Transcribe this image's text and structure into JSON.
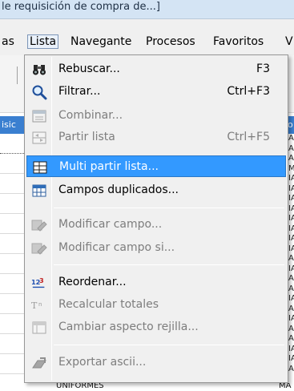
{
  "window": {
    "title": "le requisición de compra de...]"
  },
  "menubar": {
    "items": [
      {
        "label": "as"
      },
      {
        "label": "Lista"
      },
      {
        "label": "Navegante"
      },
      {
        "label": "Procesos"
      },
      {
        "label": "Favoritos"
      },
      {
        "label": "V"
      }
    ]
  },
  "grid": {
    "header_left": "isic",
    "header_right": "o",
    "right_cells": [
      "A",
      "A",
      "AC",
      "M/",
      "IA",
      "IA",
      "IA",
      "IA",
      "IA",
      "IA",
      "IA",
      "IA",
      "A",
      "IA",
      "A",
      "A",
      "IA",
      "A",
      "IA",
      "A",
      "AC",
      "IA",
      "IA",
      "A"
    ],
    "bottom_left": "UNIFORMES",
    "bottom_right": "MA"
  },
  "lista_menu": {
    "items": [
      {
        "label": "Rebuscar...",
        "shortcut": "F3",
        "icon": "binoculars-icon",
        "enabled": true
      },
      {
        "label": "Filtrar...",
        "shortcut": "Ctrl+F3",
        "icon": "magnifier-icon",
        "enabled": true
      },
      {
        "label": "Combinar...",
        "shortcut": "",
        "icon": "combine-window-icon",
        "enabled": false
      },
      {
        "label": "Partir lista",
        "shortcut": "Ctrl+F5",
        "icon": "split-list-icon",
        "enabled": false
      },
      {
        "label": "Multi partir lista...",
        "shortcut": "",
        "icon": "multi-split-icon",
        "enabled": true,
        "highlighted": true
      },
      {
        "label": "Campos duplicados...",
        "shortcut": "",
        "icon": "duplicate-fields-icon",
        "enabled": true
      },
      {
        "label": "Modificar campo...",
        "shortcut": "",
        "icon": "edit-field-icon",
        "enabled": false
      },
      {
        "label": "Modificar campo si...",
        "shortcut": "",
        "icon": "edit-field-if-icon",
        "enabled": false
      },
      {
        "label": "Reordenar...",
        "shortcut": "",
        "icon": "reorder-123-icon",
        "enabled": true
      },
      {
        "label": "Recalcular totales",
        "shortcut": "",
        "icon": "recalculate-icon",
        "enabled": false
      },
      {
        "label": "Cambiar aspecto rejilla...",
        "shortcut": "",
        "icon": "grid-aspect-icon",
        "enabled": false
      },
      {
        "label": "Exportar ascii...",
        "shortcut": "",
        "icon": "export-icon",
        "enabled": false
      }
    ]
  },
  "colors": {
    "highlight": "#3399ff",
    "menu_bg": "#f0f0f0",
    "disabled_text": "#7d7d7d",
    "grid_header": "#3a7fd0"
  }
}
